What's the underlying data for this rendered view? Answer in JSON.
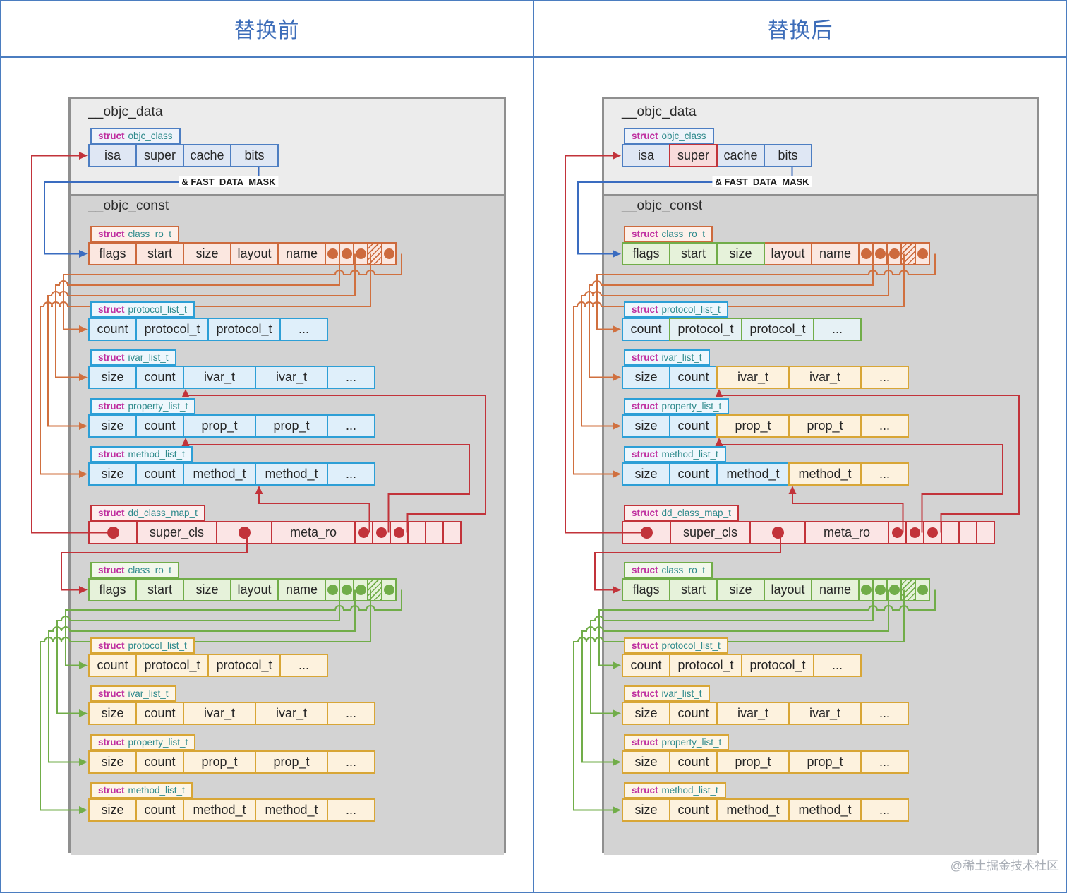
{
  "header": {
    "left": "替换前",
    "right": "替换后"
  },
  "watermark": "@稀土掘金技术社区",
  "section_titles": {
    "data": "__objc_data",
    "const": "__objc_const"
  },
  "mask_label": "& FAST_DATA_MASK",
  "colors": {
    "accent": "#4b7dc0",
    "header_text": "#3d6db9",
    "panel_border": "#8f8f8f",
    "struct_keyword": "#bf2fa0",
    "struct_name": "#2f8a8c",
    "lines": {
      "red": "#c2333a",
      "blue": "#3a6cc0",
      "orange": "#d0703f",
      "green": "#71ad49"
    },
    "themes": {
      "navy": {
        "border": "#4d7ec2",
        "fill": "#dfe7f4",
        "label": "#eef3fa",
        "dot": "#4d7ec2"
      },
      "orange": {
        "border": "#cd6a3d",
        "fill": "#fbe7e0",
        "label": "#fdf0ea",
        "dot": "#cd6a3d"
      },
      "cyan": {
        "border": "#2d9fd6",
        "fill": "#dfeffa",
        "label": "#eef7fd",
        "dot": "#2d9fd6"
      },
      "red": {
        "border": "#c2333a",
        "fill": "#fbe5e5",
        "label": "#fdefef",
        "dot": "#c2333a"
      },
      "green": {
        "border": "#71ad49",
        "fill": "#e6f2da",
        "label": "#f2f8ec",
        "dot": "#71ad49"
      },
      "yellow": {
        "border": "#d8a636",
        "fill": "#fdf2de",
        "label": "#fdf6e8",
        "dot": "#d8a636"
      },
      "hl_red": {
        "border": "#c2333a",
        "fill": "#f8dcdc"
      },
      "hl_green": {
        "border": "#71ad49",
        "fill": "#e6f2da"
      },
      "hl_greenb": {
        "border": "#71ad49",
        "fill": "#e6f1f5"
      },
      "hl_yellow": {
        "border": "#d8a636",
        "fill": "#fdf2de"
      }
    }
  },
  "panels": [
    {
      "name": "before",
      "structs": [
        {
          "label": {
            "kw": "struct",
            "nm": "objc_class"
          },
          "cells": [
            {
              "t": "isa"
            },
            {
              "t": "super"
            },
            {
              "t": "cache"
            },
            {
              "t": "bits"
            }
          ]
        },
        {
          "label": {
            "kw": "struct",
            "nm": "class_ro_t"
          },
          "cells": [
            {
              "t": "flags"
            },
            {
              "t": "start"
            },
            {
              "t": "size"
            },
            {
              "t": "layout"
            },
            {
              "t": "name"
            },
            {
              "dot": true
            },
            {
              "dot": true
            },
            {
              "dot": true
            },
            {
              "hatch": true
            },
            {
              "dot": true
            }
          ]
        },
        {
          "label": {
            "kw": "struct",
            "nm": "protocol_list_t"
          },
          "cells": [
            {
              "t": "count"
            },
            {
              "t": "protocol_t"
            },
            {
              "t": "protocol_t"
            },
            {
              "t": "..."
            }
          ]
        },
        {
          "label": {
            "kw": "struct",
            "nm": "ivar_list_t"
          },
          "cells": [
            {
              "t": "size"
            },
            {
              "t": "count"
            },
            {
              "t": "ivar_t"
            },
            {
              "t": "ivar_t"
            },
            {
              "t": "..."
            }
          ]
        },
        {
          "label": {
            "kw": "struct",
            "nm": "property_list_t"
          },
          "cells": [
            {
              "t": "size"
            },
            {
              "t": "count"
            },
            {
              "t": "prop_t"
            },
            {
              "t": "prop_t"
            },
            {
              "t": "..."
            }
          ]
        },
        {
          "label": {
            "kw": "struct",
            "nm": "method_list_t"
          },
          "cells": [
            {
              "t": "size"
            },
            {
              "t": "count"
            },
            {
              "t": "method_t"
            },
            {
              "t": "method_t"
            },
            {
              "t": "..."
            }
          ]
        },
        {
          "label": {
            "kw": "struct",
            "nm": "dd_class_map_t"
          },
          "cells": [
            {
              "dot": true
            },
            {
              "t": "super_cls"
            },
            {
              "dot": true
            },
            {
              "t": "meta_ro"
            },
            {
              "dot": true
            },
            {
              "dot": true
            },
            {
              "dot": true
            },
            {
              "empty": true
            },
            {
              "empty": true
            },
            {
              "empty": true
            }
          ]
        },
        {
          "label": {
            "kw": "struct",
            "nm": "class_ro_t"
          },
          "cells": [
            {
              "t": "flags"
            },
            {
              "t": "start"
            },
            {
              "t": "size"
            },
            {
              "t": "layout"
            },
            {
              "t": "name"
            },
            {
              "dot": true
            },
            {
              "dot": true
            },
            {
              "dot": true
            },
            {
              "hatch": true
            },
            {
              "dot": true
            }
          ]
        },
        {
          "label": {
            "kw": "struct",
            "nm": "protocol_list_t"
          },
          "cells": [
            {
              "t": "count"
            },
            {
              "t": "protocol_t"
            },
            {
              "t": "protocol_t"
            },
            {
              "t": "..."
            }
          ]
        },
        {
          "label": {
            "kw": "struct",
            "nm": "ivar_list_t"
          },
          "cells": [
            {
              "t": "size"
            },
            {
              "t": "count"
            },
            {
              "t": "ivar_t"
            },
            {
              "t": "ivar_t"
            },
            {
              "t": "..."
            }
          ]
        },
        {
          "label": {
            "kw": "struct",
            "nm": "property_list_t"
          },
          "cells": [
            {
              "t": "size"
            },
            {
              "t": "count"
            },
            {
              "t": "prop_t"
            },
            {
              "t": "prop_t"
            },
            {
              "t": "..."
            }
          ]
        },
        {
          "label": {
            "kw": "struct",
            "nm": "method_list_t"
          },
          "cells": [
            {
              "t": "size"
            },
            {
              "t": "count"
            },
            {
              "t": "method_t"
            },
            {
              "t": "method_t"
            },
            {
              "t": "..."
            }
          ]
        }
      ]
    },
    {
      "name": "after",
      "structs": [
        {
          "label": {
            "kw": "struct",
            "nm": "objc_class"
          },
          "cells": [
            {
              "t": "isa"
            },
            {
              "t": "super",
              "hl": "hl_red"
            },
            {
              "t": "cache"
            },
            {
              "t": "bits"
            }
          ]
        },
        {
          "label": {
            "kw": "struct",
            "nm": "class_ro_t"
          },
          "cells": [
            {
              "t": "flags",
              "hl": "hl_green"
            },
            {
              "t": "start",
              "hl": "hl_green"
            },
            {
              "t": "size",
              "hl": "hl_green"
            },
            {
              "t": "layout"
            },
            {
              "t": "name"
            },
            {
              "dot": true
            },
            {
              "dot": true
            },
            {
              "dot": true
            },
            {
              "hatch": true
            },
            {
              "dot": true
            }
          ]
        },
        {
          "label": {
            "kw": "struct",
            "nm": "protocol_list_t"
          },
          "cells": [
            {
              "t": "count"
            },
            {
              "t": "protocol_t",
              "hl": "hl_greenb"
            },
            {
              "t": "protocol_t",
              "hl": "hl_greenb"
            },
            {
              "t": "...",
              "hl": "hl_greenb"
            }
          ]
        },
        {
          "label": {
            "kw": "struct",
            "nm": "ivar_list_t"
          },
          "cells": [
            {
              "t": "size"
            },
            {
              "t": "count"
            },
            {
              "t": "ivar_t",
              "hl": "hl_yellow"
            },
            {
              "t": "ivar_t",
              "hl": "hl_yellow"
            },
            {
              "t": "...",
              "hl": "hl_yellow"
            }
          ]
        },
        {
          "label": {
            "kw": "struct",
            "nm": "property_list_t"
          },
          "cells": [
            {
              "t": "size"
            },
            {
              "t": "count"
            },
            {
              "t": "prop_t",
              "hl": "hl_yellow"
            },
            {
              "t": "prop_t",
              "hl": "hl_yellow"
            },
            {
              "t": "...",
              "hl": "hl_yellow"
            }
          ]
        },
        {
          "label": {
            "kw": "struct",
            "nm": "method_list_t"
          },
          "cells": [
            {
              "t": "size"
            },
            {
              "t": "count"
            },
            {
              "t": "method_t"
            },
            {
              "t": "method_t",
              "hl": "hl_yellow"
            },
            {
              "t": "...",
              "hl": "hl_yellow"
            }
          ]
        },
        {
          "label": {
            "kw": "struct",
            "nm": "dd_class_map_t"
          },
          "cells": [
            {
              "dot": true
            },
            {
              "t": "super_cls"
            },
            {
              "dot": true
            },
            {
              "t": "meta_ro"
            },
            {
              "dot": true
            },
            {
              "dot": true
            },
            {
              "dot": true
            },
            {
              "empty": true
            },
            {
              "empty": true
            },
            {
              "empty": true
            }
          ]
        },
        {
          "label": {
            "kw": "struct",
            "nm": "class_ro_t"
          },
          "cells": [
            {
              "t": "flags"
            },
            {
              "t": "start"
            },
            {
              "t": "size"
            },
            {
              "t": "layout"
            },
            {
              "t": "name"
            },
            {
              "dot": true
            },
            {
              "dot": true
            },
            {
              "dot": true
            },
            {
              "hatch": true
            },
            {
              "dot": true
            }
          ]
        },
        {
          "label": {
            "kw": "struct",
            "nm": "protocol_list_t"
          },
          "cells": [
            {
              "t": "count"
            },
            {
              "t": "protocol_t"
            },
            {
              "t": "protocol_t"
            },
            {
              "t": "..."
            }
          ]
        },
        {
          "label": {
            "kw": "struct",
            "nm": "ivar_list_t"
          },
          "cells": [
            {
              "t": "size"
            },
            {
              "t": "count"
            },
            {
              "t": "ivar_t"
            },
            {
              "t": "ivar_t"
            },
            {
              "t": "..."
            }
          ]
        },
        {
          "label": {
            "kw": "struct",
            "nm": "property_list_t"
          },
          "cells": [
            {
              "t": "size"
            },
            {
              "t": "count"
            },
            {
              "t": "prop_t"
            },
            {
              "t": "prop_t"
            },
            {
              "t": "..."
            }
          ]
        },
        {
          "label": {
            "kw": "struct",
            "nm": "method_list_t"
          },
          "cells": [
            {
              "t": "size"
            },
            {
              "t": "count"
            },
            {
              "t": "method_t"
            },
            {
              "t": "method_t"
            },
            {
              "t": "..."
            }
          ]
        }
      ]
    }
  ]
}
